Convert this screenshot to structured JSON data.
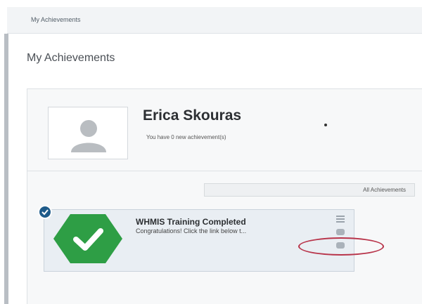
{
  "breadcrumb": {
    "label": "My Achievements"
  },
  "page": {
    "title": "My Achievements"
  },
  "profile": {
    "name": "Erica Skouras",
    "subtitle": "You have 0 new achievement(s)",
    "avatar_icon": "user-silhouette-icon"
  },
  "filter": {
    "label": "All Achievements"
  },
  "achievement": {
    "title": "WHMIS Training Completed",
    "text": "Congratulations! Click the link below t...",
    "badge_icon": "checkmark-hexagon-icon",
    "status_icon": "checked-circle-icon",
    "actions": [
      "menu-icon",
      "view-icon",
      "certificate-icon"
    ]
  },
  "colors": {
    "badge_green": "#2e9e45",
    "check_blue": "#1e5b8a",
    "highlight_red": "#b8344a"
  }
}
